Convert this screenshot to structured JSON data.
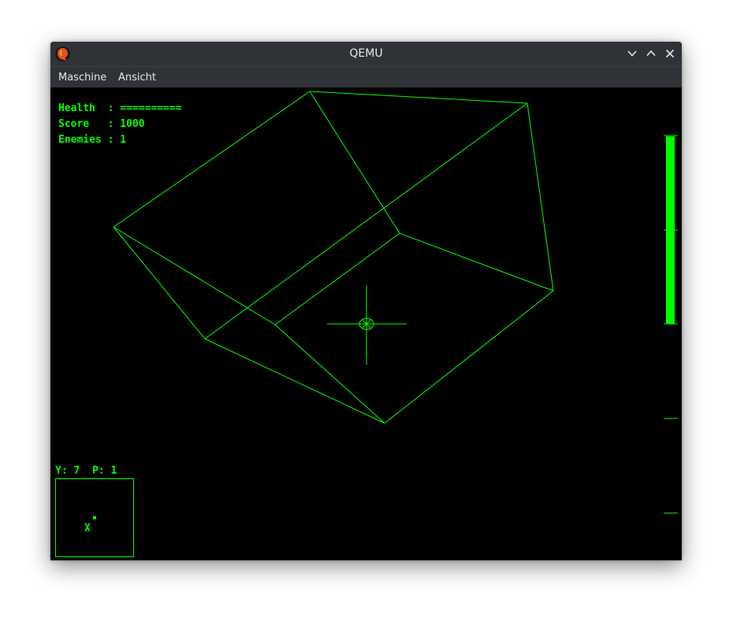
{
  "window": {
    "title": "QEMU",
    "app_icon": "qemu-logo-icon",
    "controls": {
      "minimize_icon": "chevron-down-icon",
      "maximize_icon": "chevron-up-icon",
      "close_icon": "close-icon"
    }
  },
  "menubar": {
    "items": [
      {
        "label": "Maschine"
      },
      {
        "label": "Ansicht"
      }
    ]
  },
  "hud": {
    "health_line": "Health  : ==========",
    "score_line": "Score   : 1000",
    "enemies_line": "Enemies : 1",
    "yp_line": "Y: 7  P: 1",
    "radar_marker": "X"
  },
  "colors": {
    "phosphor": "#00ff00",
    "background": "#000000",
    "chrome": "#2f3338"
  }
}
